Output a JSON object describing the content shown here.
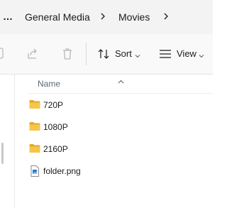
{
  "breadcrumb": {
    "more_label": "…",
    "items": [
      "General Media",
      "Movies"
    ]
  },
  "toolbar": {
    "sort_label": "Sort",
    "view_label": "View"
  },
  "file_list": {
    "column_header": "Name",
    "items": [
      {
        "name": "720P",
        "type": "folder"
      },
      {
        "name": "1080P",
        "type": "folder"
      },
      {
        "name": "2160P",
        "type": "folder"
      },
      {
        "name": "folder.png",
        "type": "image-file"
      }
    ]
  },
  "colors": {
    "folder": "#f4c64b",
    "folder_dark": "#e3a82b",
    "accent": "#2a78d6"
  }
}
